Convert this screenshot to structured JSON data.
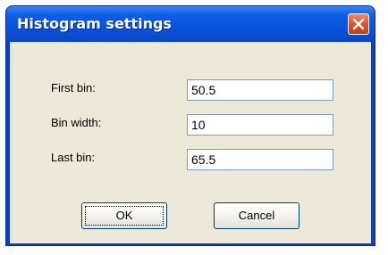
{
  "window": {
    "title": "Histogram settings",
    "close_icon": "close-icon"
  },
  "form": {
    "first_bin": {
      "label": "First bin:",
      "value": "50.5"
    },
    "bin_width": {
      "label": "Bin width:",
      "value": "10"
    },
    "last_bin": {
      "label": "Last bin:",
      "value": "65.5"
    }
  },
  "buttons": {
    "ok_label": "OK",
    "cancel_label": "Cancel"
  },
  "colors": {
    "titlebar": "#0a4fd8",
    "client_bg": "#ece9d8",
    "close_button": "#e0512b"
  }
}
